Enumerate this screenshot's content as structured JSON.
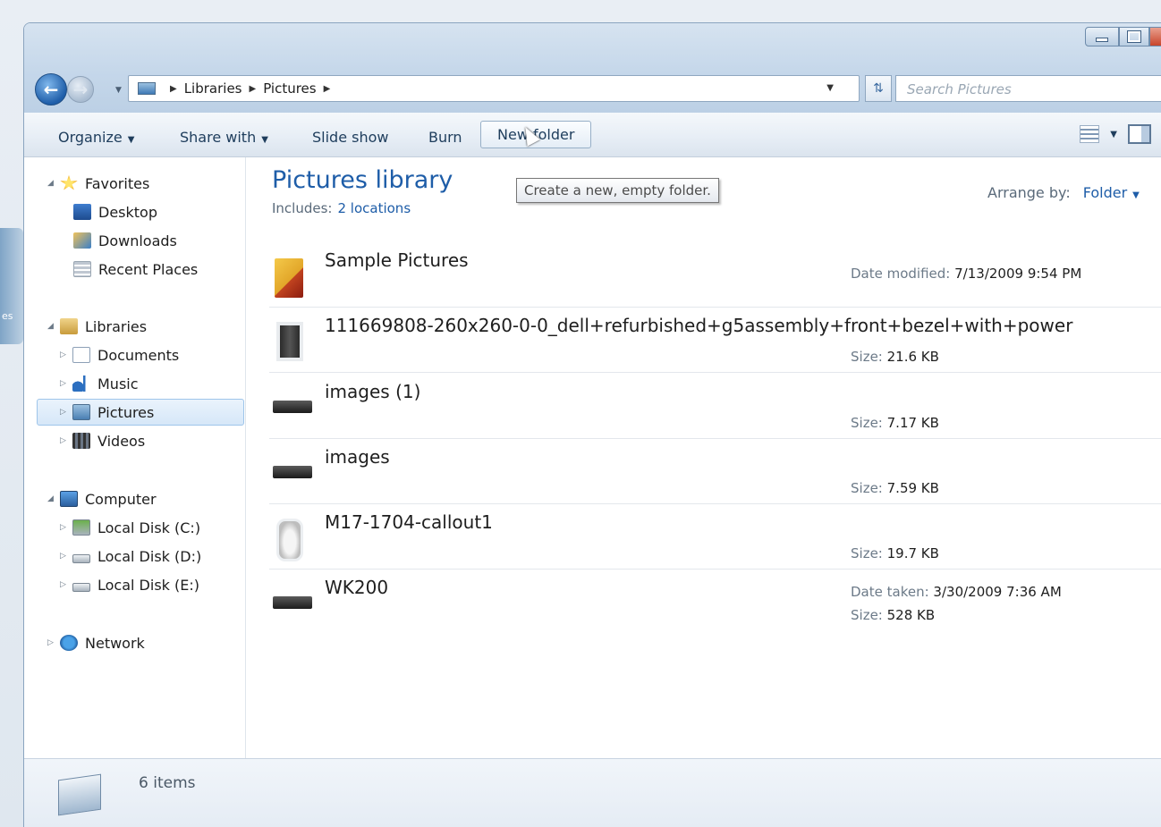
{
  "window": {
    "controls": {
      "minimize": "minimize",
      "maximize": "maximize",
      "close": "close"
    }
  },
  "nav": {
    "breadcrumb": [
      "Libraries",
      "Pictures"
    ],
    "search_placeholder": "Search Pictures"
  },
  "toolbar": {
    "organize": "Organize",
    "share_with": "Share with",
    "slide_show": "Slide show",
    "burn": "Burn",
    "new_folder": "New folder"
  },
  "tooltip": "Create a new, empty folder.",
  "sidebar": {
    "favorites": "Favorites",
    "desktop": "Desktop",
    "downloads": "Downloads",
    "recent_places": "Recent Places",
    "libraries": "Libraries",
    "documents": "Documents",
    "music": "Music",
    "pictures": "Pictures",
    "videos": "Videos",
    "computer": "Computer",
    "disk_c": "Local Disk (C:)",
    "disk_d": "Local Disk (D:)",
    "disk_e": "Local Disk (E:)",
    "network": "Network"
  },
  "content": {
    "title": "Pictures library",
    "includes_label": "Includes:",
    "includes_link": "2 locations",
    "arrange_label": "Arrange by:",
    "arrange_value": "Folder"
  },
  "files": [
    {
      "name": "Sample Pictures",
      "meta1_label": "Date modified:",
      "meta1_value": "7/13/2009 9:54 PM",
      "icon": "folder-icon"
    },
    {
      "name": "111669808-260x260-0-0_dell+refurbished+g5assembly+front+bezel+with+power",
      "meta1_label": "Size:",
      "meta1_value": "21.6 KB",
      "icon": "tower-pc-icon"
    },
    {
      "name": "images (1)",
      "meta1_label": "Size:",
      "meta1_value": "7.17 KB",
      "icon": "device-icon"
    },
    {
      "name": "images",
      "meta1_label": "Size:",
      "meta1_value": "7.59 KB",
      "icon": "device-icon"
    },
    {
      "name": "M17-1704-callout1",
      "meta1_label": "Size:",
      "meta1_value": "19.7 KB",
      "icon": "mouse-icon"
    },
    {
      "name": "WK200",
      "meta1_label": "Date taken:",
      "meta1_value": "3/30/2009 7:36 AM",
      "meta2_label": "Size:",
      "meta2_value": "528 KB",
      "icon": "keyboard-icon"
    }
  ],
  "status": {
    "count": "6 items"
  },
  "desktop_fragment": "es"
}
